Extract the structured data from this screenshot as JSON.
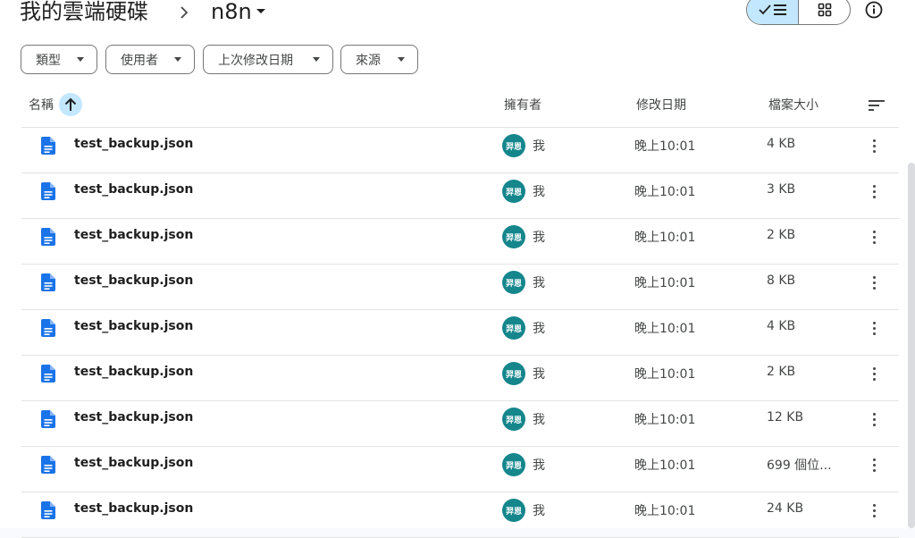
{
  "breadcrumb": {
    "root": "我的雲端硬碟",
    "current": "n8n"
  },
  "filters": [
    {
      "label": "類型"
    },
    {
      "label": "使用者"
    },
    {
      "label": "上次修改日期"
    },
    {
      "label": "來源"
    }
  ],
  "columns": {
    "name": "名稱",
    "owner": "擁有者",
    "modified": "修改日期",
    "size": "檔案大小"
  },
  "avatar_text": "羿恩",
  "colors": {
    "accent": "#c2e7ff",
    "file_icon": "#1a73e8",
    "avatar": "#14868c"
  },
  "files": [
    {
      "name": "test_backup.json",
      "owner": "我",
      "modified": "晚上10:01",
      "size": "4 KB"
    },
    {
      "name": "test_backup.json",
      "owner": "我",
      "modified": "晚上10:01",
      "size": "3 KB"
    },
    {
      "name": "test_backup.json",
      "owner": "我",
      "modified": "晚上10:01",
      "size": "2 KB"
    },
    {
      "name": "test_backup.json",
      "owner": "我",
      "modified": "晚上10:01",
      "size": "8 KB"
    },
    {
      "name": "test_backup.json",
      "owner": "我",
      "modified": "晚上10:01",
      "size": "4 KB"
    },
    {
      "name": "test_backup.json",
      "owner": "我",
      "modified": "晚上10:01",
      "size": "2 KB"
    },
    {
      "name": "test_backup.json",
      "owner": "我",
      "modified": "晚上10:01",
      "size": "12 KB"
    },
    {
      "name": "test_backup.json",
      "owner": "我",
      "modified": "晚上10:01",
      "size": "699 個位..."
    },
    {
      "name": "test_backup.json",
      "owner": "我",
      "modified": "晚上10:01",
      "size": "24 KB"
    }
  ]
}
